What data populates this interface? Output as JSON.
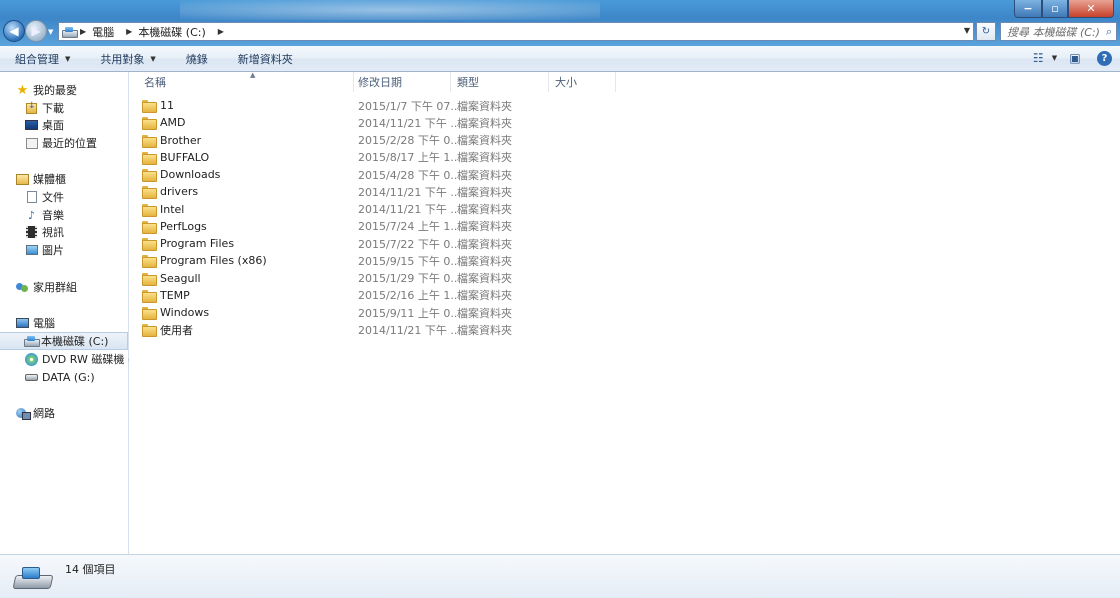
{
  "window": {
    "minimize": "−",
    "maximize": "▫",
    "close": "✕"
  },
  "nav": {
    "back": "◀",
    "forward": "▶"
  },
  "address": {
    "crumbs": [
      "電腦",
      "本機磁碟 (C:)"
    ]
  },
  "search": {
    "placeholder": "搜尋 本機磁碟 (C:)"
  },
  "toolbar": {
    "organize": "組合管理",
    "share": "共用對象",
    "burn": "燒錄",
    "new_folder": "新增資料夾"
  },
  "sidebar": {
    "favorites": "我的最愛",
    "downloads": "下載",
    "desktop": "桌面",
    "recent": "最近的位置",
    "libraries": "媒體櫃",
    "documents": "文件",
    "music": "音樂",
    "videos": "視訊",
    "pictures": "圖片",
    "homegroup": "家用群組",
    "computer": "電腦",
    "drive_c": "本機磁碟 (C:)",
    "drive_dvd": "DVD RW 磁碟機 (D",
    "drive_g": "DATA (G:)",
    "network": "網路"
  },
  "columns": {
    "name": "名稱",
    "date": "修改日期",
    "type": "類型",
    "size": "大小"
  },
  "files": [
    {
      "name": "11",
      "date": "2015/1/7 下午 07...",
      "type": "檔案資料夾"
    },
    {
      "name": "AMD",
      "date": "2014/11/21 下午 ...",
      "type": "檔案資料夾"
    },
    {
      "name": "Brother",
      "date": "2015/2/28 下午 0...",
      "type": "檔案資料夾"
    },
    {
      "name": "BUFFALO",
      "date": "2015/8/17 上午 1...",
      "type": "檔案資料夾"
    },
    {
      "name": "Downloads",
      "date": "2015/4/28 下午 0...",
      "type": "檔案資料夾"
    },
    {
      "name": "drivers",
      "date": "2014/11/21 下午 ...",
      "type": "檔案資料夾"
    },
    {
      "name": "Intel",
      "date": "2014/11/21 下午 ...",
      "type": "檔案資料夾"
    },
    {
      "name": "PerfLogs",
      "date": "2015/7/24 上午 1...",
      "type": "檔案資料夾"
    },
    {
      "name": "Program Files",
      "date": "2015/7/22 下午 0...",
      "type": "檔案資料夾"
    },
    {
      "name": "Program Files (x86)",
      "date": "2015/9/15 下午 0...",
      "type": "檔案資料夾"
    },
    {
      "name": "Seagull",
      "date": "2015/1/29 下午 0...",
      "type": "檔案資料夾"
    },
    {
      "name": "TEMP",
      "date": "2015/2/16 上午 1...",
      "type": "檔案資料夾"
    },
    {
      "name": "Windows",
      "date": "2015/9/11 上午 0...",
      "type": "檔案資料夾"
    },
    {
      "name": "使用者",
      "date": "2014/11/21 下午 ...",
      "type": "檔案資料夾"
    }
  ],
  "status": {
    "item_count": "14 個項目"
  }
}
